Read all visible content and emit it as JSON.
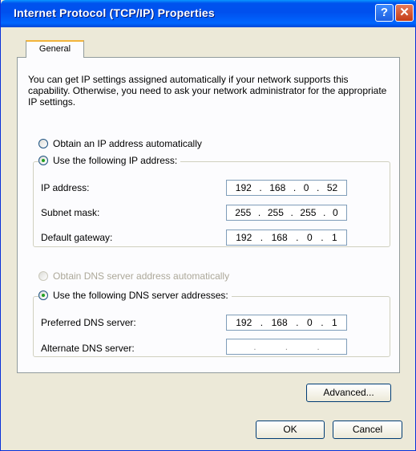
{
  "window": {
    "title": "Internet Protocol (TCP/IP) Properties",
    "help_glyph": "?",
    "close_glyph": "✕"
  },
  "tabs": [
    {
      "label": "General"
    }
  ],
  "intro": "You can get IP settings assigned automatically if your network supports this capability. Otherwise, you need to ask your network administrator for the appropriate IP settings.",
  "ip": {
    "auto_label": "Obtain an IP address automatically",
    "manual_label": "Use the following IP address:",
    "selected": "manual",
    "fields": [
      {
        "label": "IP address:",
        "octets": [
          "192",
          "168",
          "0",
          "52"
        ]
      },
      {
        "label": "Subnet mask:",
        "octets": [
          "255",
          "255",
          "255",
          "0"
        ]
      },
      {
        "label": "Default gateway:",
        "octets": [
          "192",
          "168",
          "0",
          "1"
        ]
      }
    ]
  },
  "dns": {
    "auto_label": "Obtain DNS server address automatically",
    "manual_label": "Use the following DNS server addresses:",
    "selected": "manual",
    "fields": [
      {
        "label": "Preferred DNS server:",
        "octets": [
          "192",
          "168",
          "0",
          "1"
        ]
      },
      {
        "label": "Alternate DNS server:",
        "octets": [
          "",
          "",
          "",
          ""
        ]
      }
    ]
  },
  "buttons": {
    "advanced": "Advanced...",
    "ok": "OK",
    "cancel": "Cancel"
  },
  "colors": {
    "titlebar": "#0054e3",
    "face": "#ece9d8",
    "close": "#c43c16",
    "radio_dot": "#21a121"
  }
}
